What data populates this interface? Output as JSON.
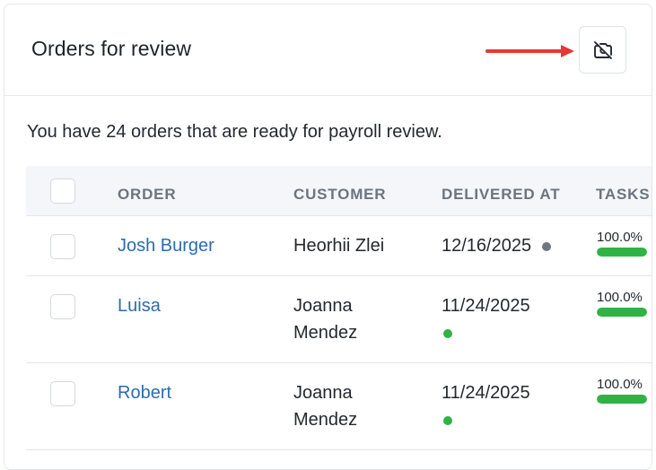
{
  "header": {
    "title": "Orders for review",
    "icon_button_icon": "camera-off-icon",
    "annotation": "red-arrow"
  },
  "summary": "You have 24 orders that are ready for payroll review.",
  "table": {
    "columns": [
      "ORDER",
      "CUSTOMER",
      "DELIVERED AT",
      "TASKS"
    ],
    "rows": [
      {
        "order": "Josh Burger",
        "customer_line1": "Heorhii Zlei",
        "customer_line2": "",
        "delivered": "12/16/2025",
        "status_color": "#6f7782",
        "tasks_pct": "100.0%",
        "tasks_value": 1.0
      },
      {
        "order": "Luisa",
        "customer_line1": "Joanna",
        "customer_line2": "Mendez",
        "delivered": "11/24/2025",
        "status_color": "#2fb344",
        "tasks_pct": "100.0%",
        "tasks_value": 1.0
      },
      {
        "order": "Robert",
        "customer_line1": "Joanna",
        "customer_line2": "Mendez",
        "delivered": "11/24/2025",
        "status_color": "#2fb344",
        "tasks_pct": "100.0%",
        "tasks_value": 1.0
      }
    ]
  },
  "colors": {
    "link": "#2b6cb0",
    "progress": "#2fb344",
    "arrow": "#e53935"
  }
}
